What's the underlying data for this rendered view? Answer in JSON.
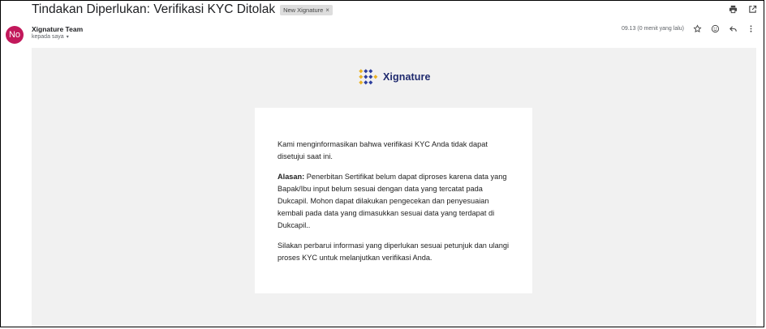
{
  "email": {
    "subject": "Tindakan Diperlukan: Verifikasi KYC Ditolak",
    "label_chip": "New Xignature",
    "label_chip_close": "×",
    "sender": {
      "avatar_initials": "No",
      "name": "Xignature Team",
      "recipient": "kepada saya",
      "recipient_caret": "▾"
    },
    "timestamp": "09.13 (0 menit yang lalu)",
    "icons": {
      "print": "print-icon",
      "open_new_window": "open-in-new-icon",
      "star": "star-icon",
      "emoji": "emoji-icon",
      "reply": "reply-icon",
      "more": "more-vert-icon"
    }
  },
  "body": {
    "brand_name": "Xignature",
    "brand_colors": {
      "navy": "#1f2a6e",
      "gold": "#e9b224",
      "blue": "#2d3f9e"
    },
    "paragraph1": "Kami menginformasikan bahwa verifikasi KYC Anda tidak dapat disetujui saat ini.",
    "reason_label": "Alasan:",
    "reason_text": " Penerbitan Sertifikat belum dapat diproses karena data yang Bapak/Ibu input belum sesuai dengan data yang tercatat pada Dukcapil. Mohon dapat dilakukan pengecekan dan penyesuaian kembali pada data yang dimasukkan sesuai data yang terdapat di Dukcapil..",
    "paragraph3": "Silakan perbarui informasi yang diperlukan sesuai petunjuk dan ulangi proses KYC untuk melanjutkan verifikasi Anda."
  },
  "colors": {
    "avatar_bg": "#c2185b",
    "body_bg": "#f1f1f1",
    "card_bg": "#ffffff"
  }
}
